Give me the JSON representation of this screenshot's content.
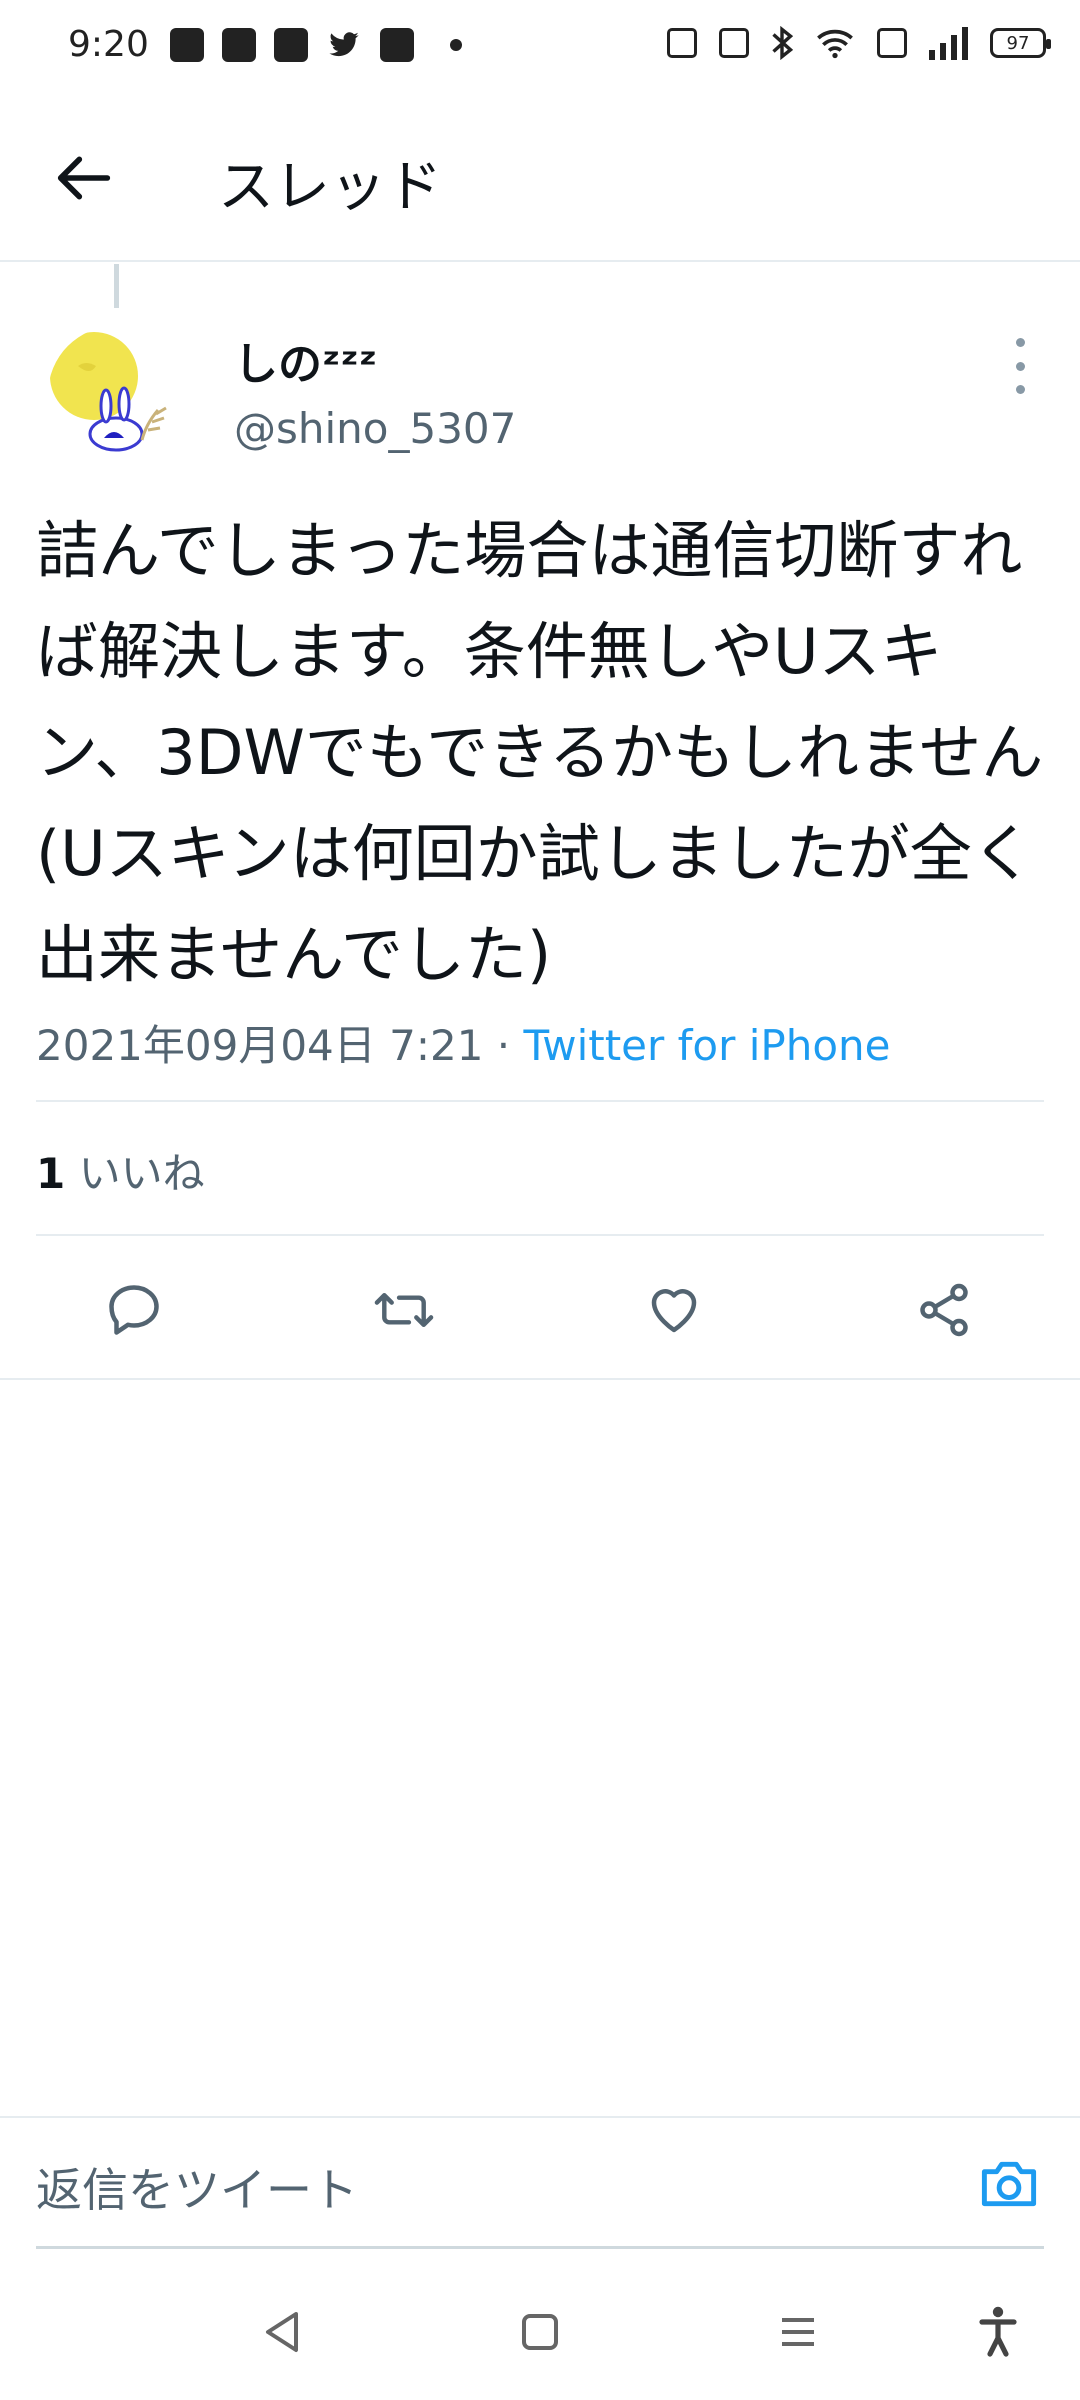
{
  "status_bar": {
    "time": "9:20",
    "battery": "97",
    "left_icons": [
      "news-icon",
      "yahoo-icon",
      "app-icon",
      "twitter-icon",
      "twitch-icon",
      "dot-icon"
    ],
    "right_icons": [
      "nfc-icon",
      "mute-icon",
      "bluetooth-icon",
      "wifi-icon",
      "volte-icon",
      "signal-icon",
      "battery-icon"
    ]
  },
  "header": {
    "title": "スレッド"
  },
  "tweet": {
    "display_name": "しのᶻᶻᶻ",
    "username": "@shino_5307",
    "text": "詰んでしまった場合は通信切断すれば解決します。条件無しやUスキン、3DWでもできるかもしれません(Uスキンは何回か試しましたが全く出来ませんでした)",
    "datetime": "2021年09月04日 7:21",
    "separator": " · ",
    "source": "Twitter for iPhone",
    "like_count": "1",
    "like_label": "いいね"
  },
  "reply": {
    "placeholder": "返信をツイート"
  },
  "colors": {
    "accent": "#1d9bf0",
    "text": "#0f1419",
    "secondary": "#536471",
    "divider": "#e6ecf0"
  }
}
